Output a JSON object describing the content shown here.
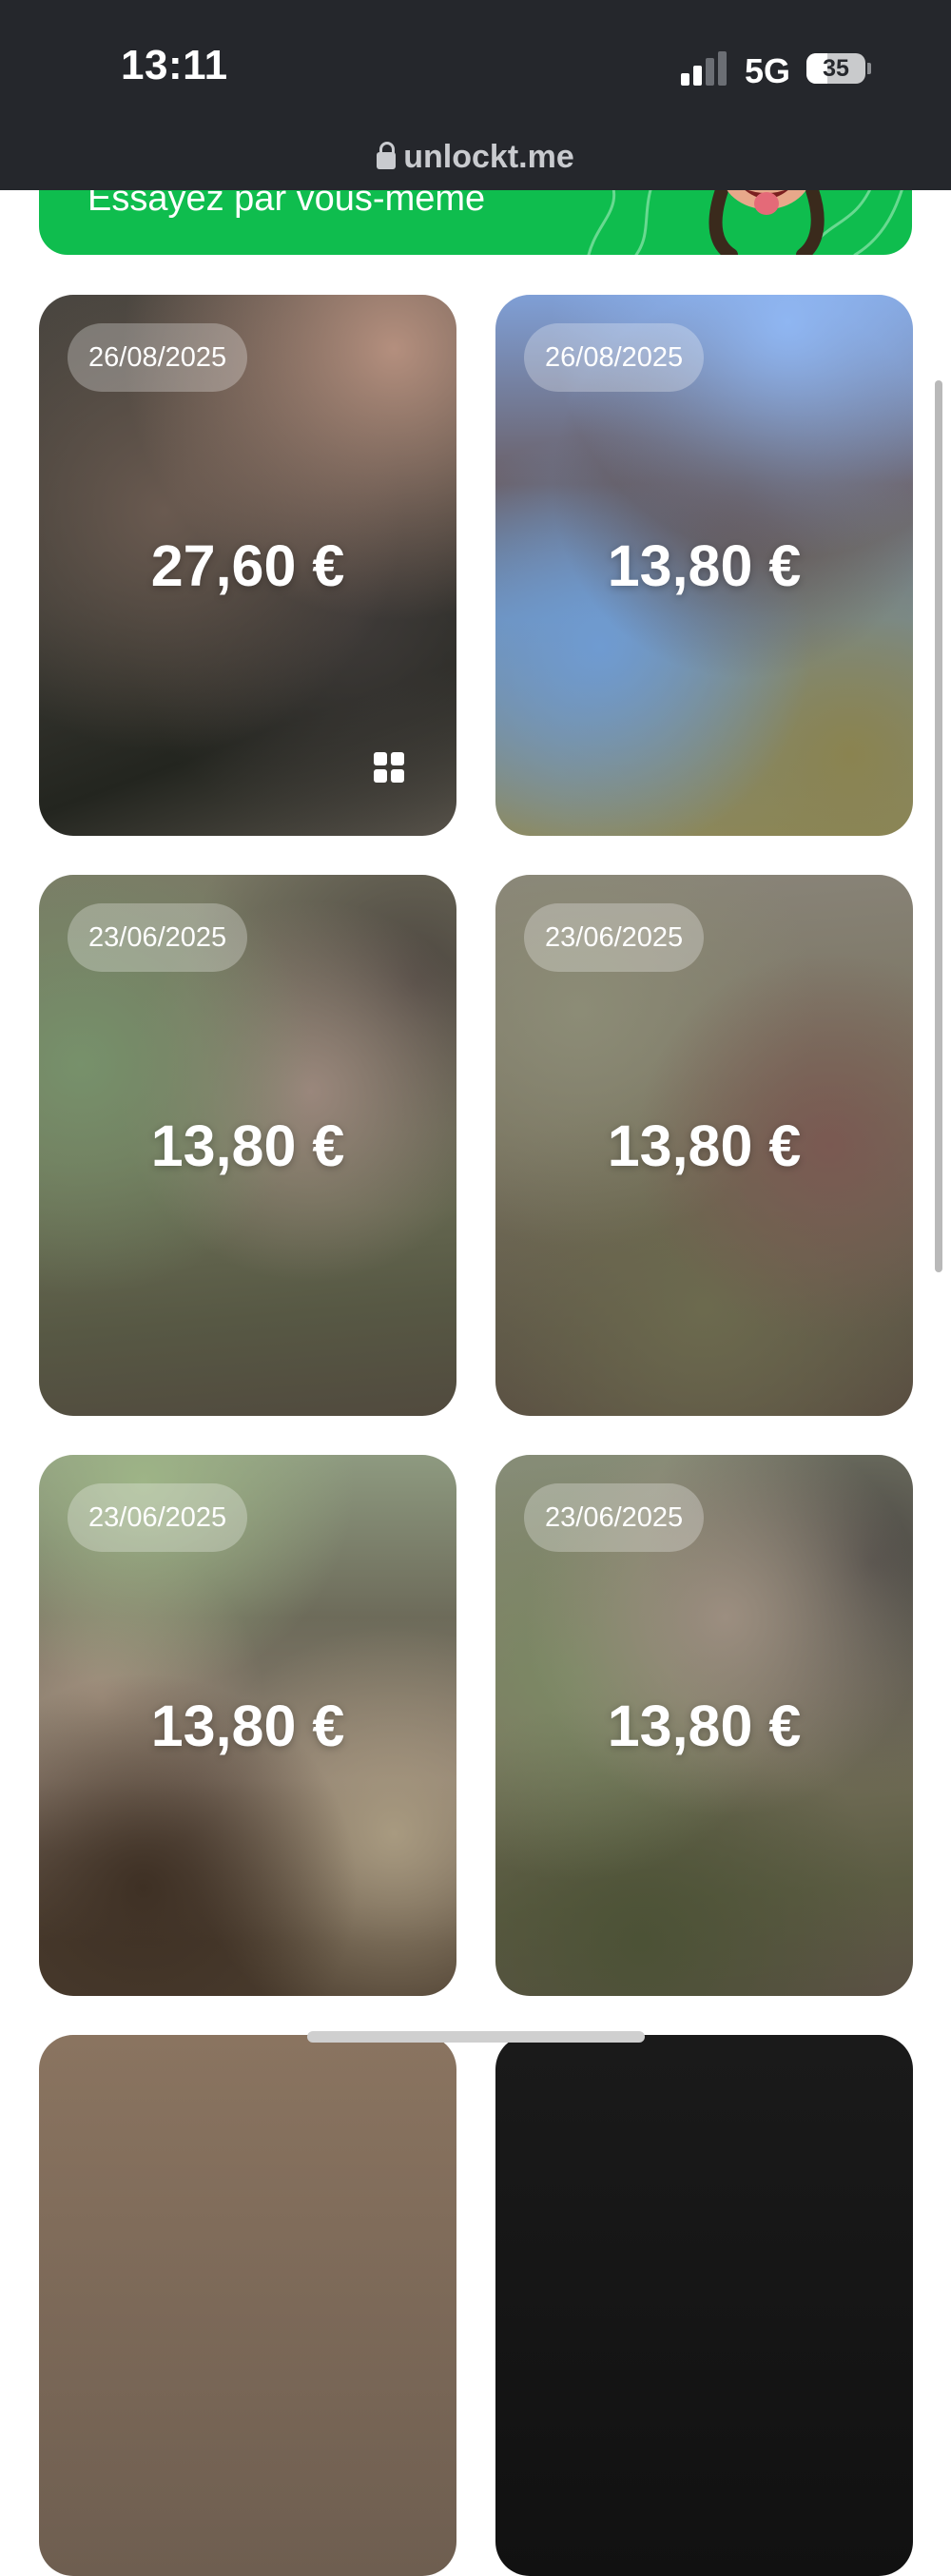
{
  "status_bar": {
    "time": "13:11",
    "network": "5G",
    "battery": "35",
    "url": "unlockt.me",
    "background": "#25272c"
  },
  "banner": {
    "text": "Essayez par vous-même",
    "color": "#0fbd4e"
  },
  "cards": [
    {
      "date": "26/08/2025",
      "price": "27,60 €",
      "multiple": true,
      "gradient": "radial-gradient(circle at 85% 10%, #b48f7e 0%, rgba(180,143,126,0) 45%), radial-gradient(circle at 30% 40%, #6a5a50 0%, rgba(106,90,80,0) 55%), radial-gradient(circle at 75% 60%, #3e3a38 0%, rgba(62,58,56,0) 50%), linear-gradient(160deg, #4a4640 0%, #3b3a34 45%, #23251f 75%, #57524a 100%)"
    },
    {
      "date": "26/08/2025",
      "price": "13,80 €",
      "multiple": false,
      "gradient": "radial-gradient(circle at 70% 5%, #8fb6f2 0%, rgba(143,182,242,0) 40%), radial-gradient(circle at 60% 35%, #5e4d4a 0%, rgba(94,77,74,0) 45%), radial-gradient(circle at 25% 65%, #6f9bd1 0%, rgba(111,155,209,0) 45%), radial-gradient(circle at 85% 85%, #8a8350 0%, rgba(138,131,80,0) 50%), linear-gradient(180deg, #7f9fd6 0%, #6a5f66 35%, #6d8fb8 60%, #8d8a60 100%)"
    },
    {
      "date": "23/06/2025",
      "price": "13,80 €",
      "multiple": false,
      "gradient": "radial-gradient(circle at 10% 35%, #77916b 0%, rgba(119,145,107,0) 45%), radial-gradient(circle at 65% 40%, #9a877c 0%, rgba(154,135,124,0) 45%), radial-gradient(circle at 90% 20%, #4d4640 0%, rgba(77,70,64,0) 40%), linear-gradient(175deg, #7b7a66 0%, #6e7258 50%, #575844 80%, #514a3e 100%)"
    },
    {
      "date": "23/06/2025",
      "price": "13,80 €",
      "multiple": false,
      "gradient": "radial-gradient(circle at 80% 50%, #7a5952 0%, rgba(122,89,82,0) 45%), radial-gradient(circle at 20% 25%, #8c8c76 0%, rgba(140,140,118,0) 45%), radial-gradient(circle at 50% 80%, #6c6a4e 0%, rgba(108,106,78,0) 50%), linear-gradient(175deg, #8a857a 0%, #77715d 45%, #5f5848 80%, #584c40 100%)"
    },
    {
      "date": "23/06/2025",
      "price": "13,80 €",
      "multiple": false,
      "gradient": "radial-gradient(circle at 25% 5%, #9eb487 0%, rgba(158,180,135,0) 35%), radial-gradient(circle at 25% 80%, #3e3024 0%, rgba(62,48,36,0) 40%), radial-gradient(circle at 85% 70%, #a89a80 0%, rgba(168,154,128,0) 40%), radial-gradient(circle at 15% 45%, #a1907e 0%, rgba(161,144,126,0) 35%), linear-gradient(180deg, #8e9a80 0%, #6d6b5a 30%, #8a7a6e 60%, #4a3c2e 90%)"
    },
    {
      "date": "23/06/2025",
      "price": "13,80 €",
      "multiple": false,
      "gradient": "radial-gradient(circle at 55% 30%, #9c8e80 0%, rgba(156,142,128,0) 45%), radial-gradient(circle at 90% 20%, #4b4844 0%, rgba(75,72,68,0) 40%), radial-gradient(circle at 20% 40%, #7b8a64 0%, rgba(123,138,100,0) 45%), radial-gradient(circle at 35% 90%, #4c5236 0%, rgba(76,82,54,0) 45%), linear-gradient(175deg, #868d77 0%, #7e7763 45%, #5c5c43 80%, #5a5044 100%)"
    }
  ],
  "partial_cards": [
    {
      "gradient": "linear-gradient(180deg, #8a7460 0%, #6e5e50 100%)"
    },
    {
      "gradient": "linear-gradient(180deg, #1a1a1a 0%, #111111 100%)"
    }
  ]
}
